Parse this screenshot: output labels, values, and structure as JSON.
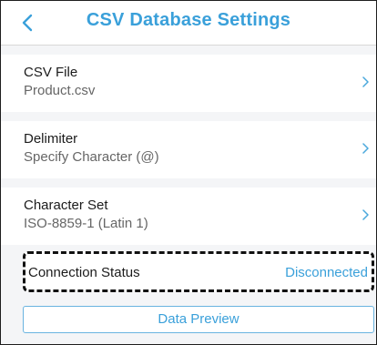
{
  "header": {
    "title": "CSV Database Settings",
    "back_icon": "chevron-left-icon"
  },
  "settings": [
    {
      "title": "CSV File",
      "value": "Product.csv",
      "icon": "chevron-right-icon"
    },
    {
      "title": "Delimiter",
      "value": "Specify Character (@)",
      "icon": "chevron-right-icon"
    },
    {
      "title": "Character Set",
      "value": "ISO-8859-1 (Latin 1)",
      "icon": "chevron-right-icon"
    }
  ],
  "connection": {
    "label": "Connection Status",
    "status": "Disconnected"
  },
  "preview_button": {
    "label": "Data Preview"
  },
  "colors": {
    "accent": "#3aa0da",
    "background": "#f4f5f7",
    "text": "#1b1b1b",
    "secondary_text": "#666666",
    "highlight_border": "#111111"
  }
}
